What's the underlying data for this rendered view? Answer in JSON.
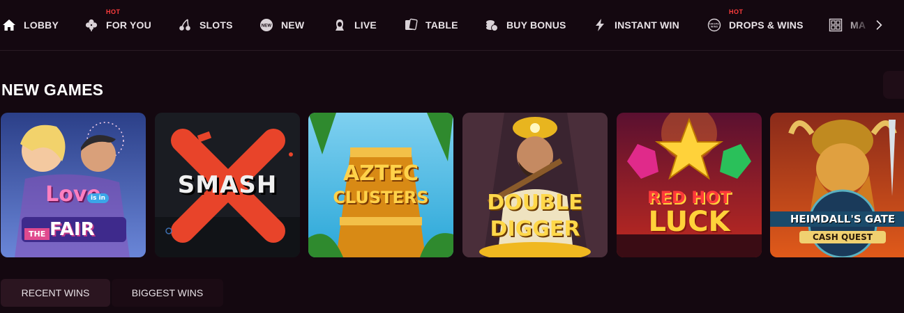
{
  "nav": {
    "items": [
      {
        "label": "LOBBY",
        "icon": "home-icon"
      },
      {
        "label": "FOR YOU",
        "icon": "clover-icon",
        "badge": "HOT"
      },
      {
        "label": "SLOTS",
        "icon": "cherries-icon"
      },
      {
        "label": "NEW",
        "icon": "new-badge-icon"
      },
      {
        "label": "LIVE",
        "icon": "dealer-icon"
      },
      {
        "label": "TABLE",
        "icon": "cards-icon"
      },
      {
        "label": "BUY BONUS",
        "icon": "coins-icon"
      },
      {
        "label": "INSTANT WIN",
        "icon": "lightning-icon"
      },
      {
        "label": "DROPS & WINS",
        "icon": "drops-wins-icon",
        "badge": "HOT"
      },
      {
        "label": "MA",
        "icon": "grid-icon"
      }
    ],
    "hot_color": "#ff3d3d"
  },
  "new_games": {
    "title": "NEW GAMES",
    "games": [
      {
        "title_line1": "Love",
        "title_small": "is in",
        "title_the": "THE",
        "title_line2": "FAIR",
        "theme": "#5a7fd6"
      },
      {
        "title_line1": "SMASH",
        "theme": "#e8442a"
      },
      {
        "title_line1": "AZTEC",
        "title_line2": "CLUSTERS",
        "theme": "#f0a820"
      },
      {
        "title_line1": "DOUBLE",
        "title_line2": "DIGGER",
        "theme": "#e8b51f"
      },
      {
        "title_line1": "RED HOT",
        "title_line2": "LUCK",
        "theme": "#e02a3a"
      },
      {
        "title_line1": "HEIMDALL'S GATE",
        "title_line2": "CASH QUEST",
        "theme": "#d4a020"
      }
    ]
  },
  "tabs": {
    "recent": "RECENT WINS",
    "biggest": "BIGGEST WINS"
  }
}
